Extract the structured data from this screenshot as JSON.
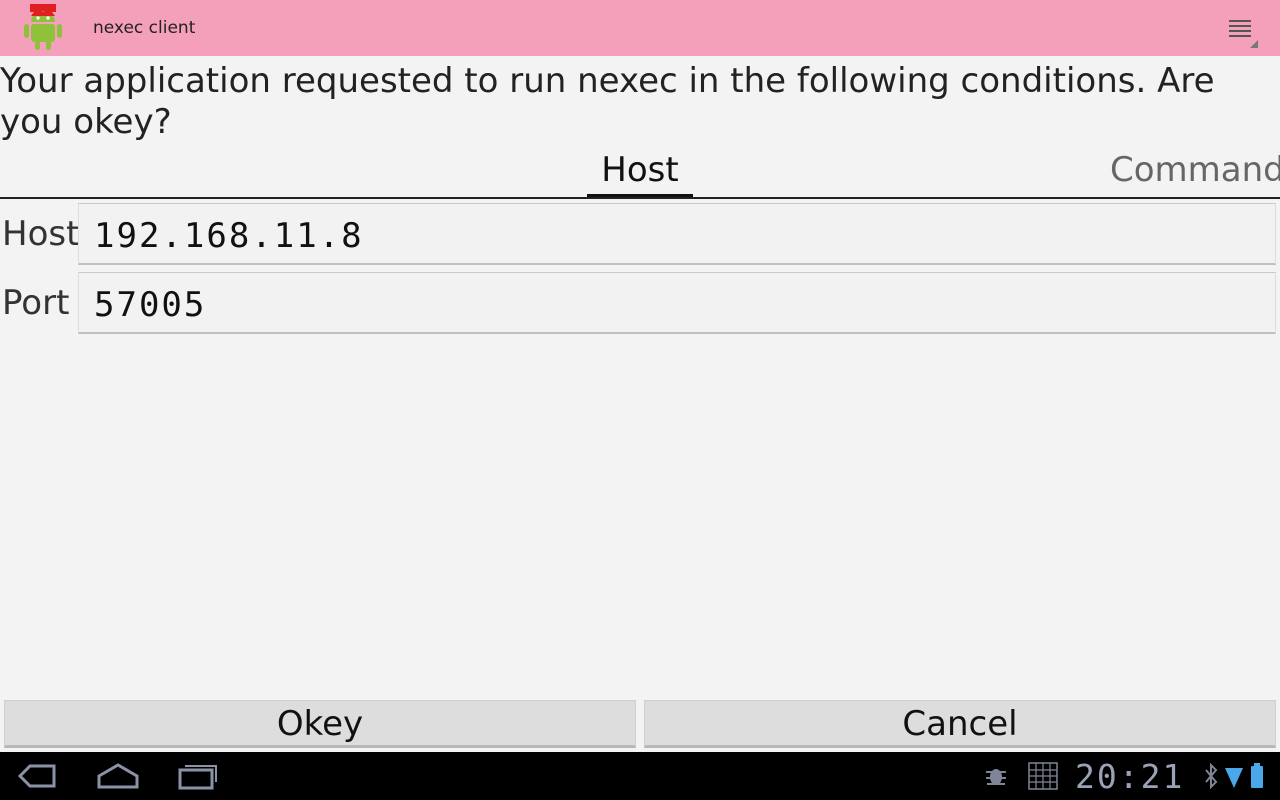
{
  "app": {
    "title": "nexec client",
    "icon": "android-robot-icon"
  },
  "prompt": "Your application requested to run nexec in the following conditions. Are you okey?",
  "tabs": [
    {
      "label": "Host",
      "selected": true
    },
    {
      "label": "Command",
      "selected": false
    }
  ],
  "form": {
    "host": {
      "label": "Host",
      "value": "192.168.11.8"
    },
    "port": {
      "label": "Port",
      "value": "57005"
    }
  },
  "buttons": {
    "okey": "Okey",
    "cancel": "Cancel"
  },
  "status": {
    "time": "20:21"
  },
  "colors": {
    "actionbar": "#f5a0bb",
    "background": "#f3f3f3",
    "status_clock": "#9aa3b4"
  }
}
